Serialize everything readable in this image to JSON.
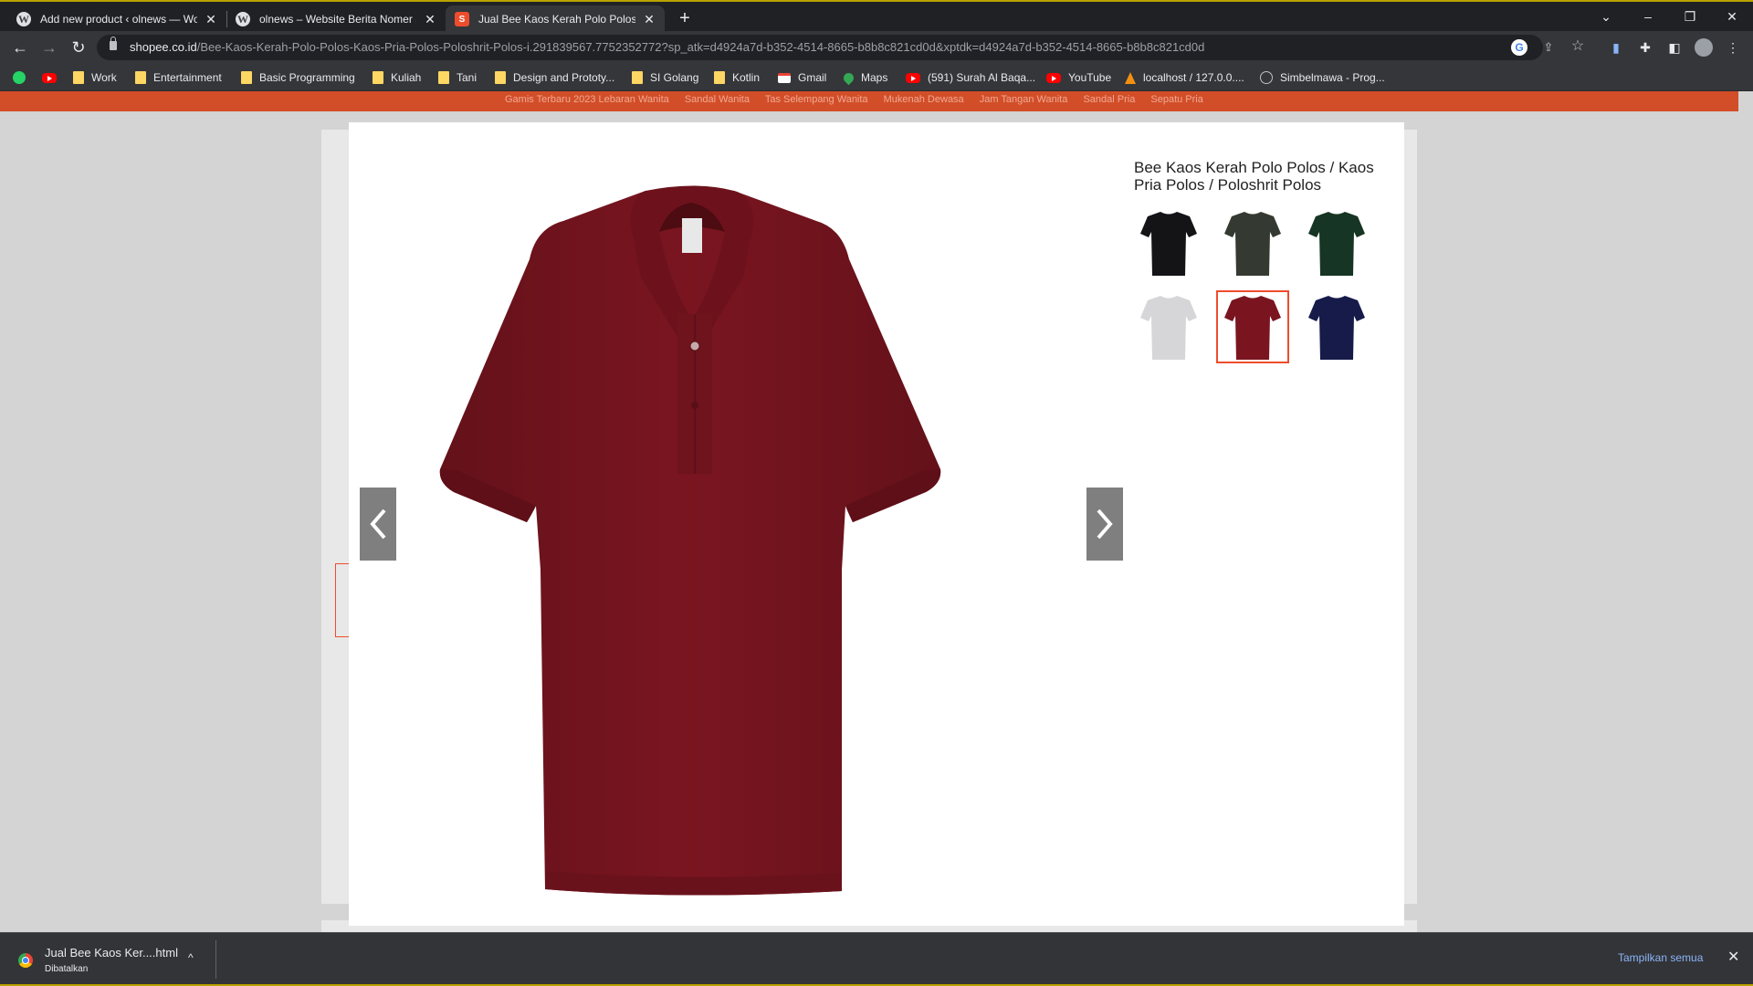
{
  "tabs": [
    {
      "title": "Add new product ‹ olnews — WordPress",
      "icon": "wordpress-icon",
      "active": false
    },
    {
      "title": "olnews – Website Berita Nomer Satu",
      "icon": "wordpress-icon",
      "active": false
    },
    {
      "title": "Jual Bee Kaos Kerah Polo Polos / Kaos",
      "icon": "shopee-icon",
      "active": true
    }
  ],
  "new_tab_symbol": "+",
  "window_controls": {
    "tab_search": "⌄",
    "minimize": "–",
    "restore": "❐",
    "close": "✕"
  },
  "toolbar": {
    "back": "←",
    "forward": "→",
    "reload": "↻",
    "url_host": "shopee.co.id",
    "url_path": "/Bee-Kaos-Kerah-Polo-Polos-Kaos-Pria-Polos-Poloshrit-Polos-i.291839567.7752352772?sp_atk=d4924a7d-b352-4514-8665-b8b8c821cd0d&xptdk=d4924a7d-b352-4514-8665-b8b8c821cd0d",
    "icons": [
      "google-lens-icon",
      "share-icon",
      "star-icon",
      "extension-docs-icon",
      "puzzle-icon",
      "side-panel-icon",
      "profile-avatar-icon",
      "kebab-menu-icon"
    ]
  },
  "bookmarks": [
    {
      "label": "",
      "icon": "whatsapp-icon"
    },
    {
      "label": "",
      "icon": "youtube-icon"
    },
    {
      "label": "Work",
      "icon": "folder-icon"
    },
    {
      "label": "Entertainment",
      "icon": "folder-icon"
    },
    {
      "label": "Basic Programming",
      "icon": "folder-icon"
    },
    {
      "label": "Kuliah",
      "icon": "folder-icon"
    },
    {
      "label": "Tani",
      "icon": "folder-icon"
    },
    {
      "label": "Design and Prototy...",
      "icon": "folder-icon"
    },
    {
      "label": "SI Golang",
      "icon": "folder-icon"
    },
    {
      "label": "Kotlin",
      "icon": "folder-icon"
    },
    {
      "label": "Gmail",
      "icon": "gmail-icon"
    },
    {
      "label": "Maps",
      "icon": "maps-icon"
    },
    {
      "label": "(591) Surah Al Baqa...",
      "icon": "youtube-icon"
    },
    {
      "label": "YouTube",
      "icon": "youtube-icon"
    },
    {
      "label": "localhost / 127.0.0....",
      "icon": "phpmyadmin-icon"
    },
    {
      "label": "Simbelmawa - Prog...",
      "icon": "globe-icon"
    }
  ],
  "shopee_header_links": [
    "Gamis Terbaru 2023 Lebaran Wanita",
    "Sandal Wanita",
    "Tas Selempang Wanita",
    "Mukenah Dewasa",
    "Jam Tangan Wanita",
    "Sandal Pria",
    "Sepatu Pria"
  ],
  "product": {
    "title": "Bee Kaos Kerah Polo Polos / Kaos Pria Polos / Poloshrit Polos",
    "main_color": "#7a1520",
    "variants": [
      {
        "color_name": "black",
        "color": "#141417",
        "selected": false
      },
      {
        "color_name": "dark-olive",
        "color": "#343a31",
        "selected": false
      },
      {
        "color_name": "dark-green",
        "color": "#163524",
        "selected": false
      },
      {
        "color_name": "light-grey",
        "color": "#d6d6d8",
        "selected": false
      },
      {
        "color_name": "maroon",
        "color": "#7a1520",
        "selected": true
      },
      {
        "color_name": "navy",
        "color": "#161b4a",
        "selected": false
      }
    ],
    "prev_label": "‹",
    "next_label": "›"
  },
  "download_bar": {
    "file_name": "Jual Bee Kaos Ker....html",
    "status": "Dibatalkan",
    "caret": "^",
    "show_all": "Tampilkan semua",
    "close": "✕"
  },
  "colors": {
    "shopee_orange": "#ee4d2d",
    "chrome_dark": "#202124",
    "chrome_toolbar": "#35363a"
  }
}
